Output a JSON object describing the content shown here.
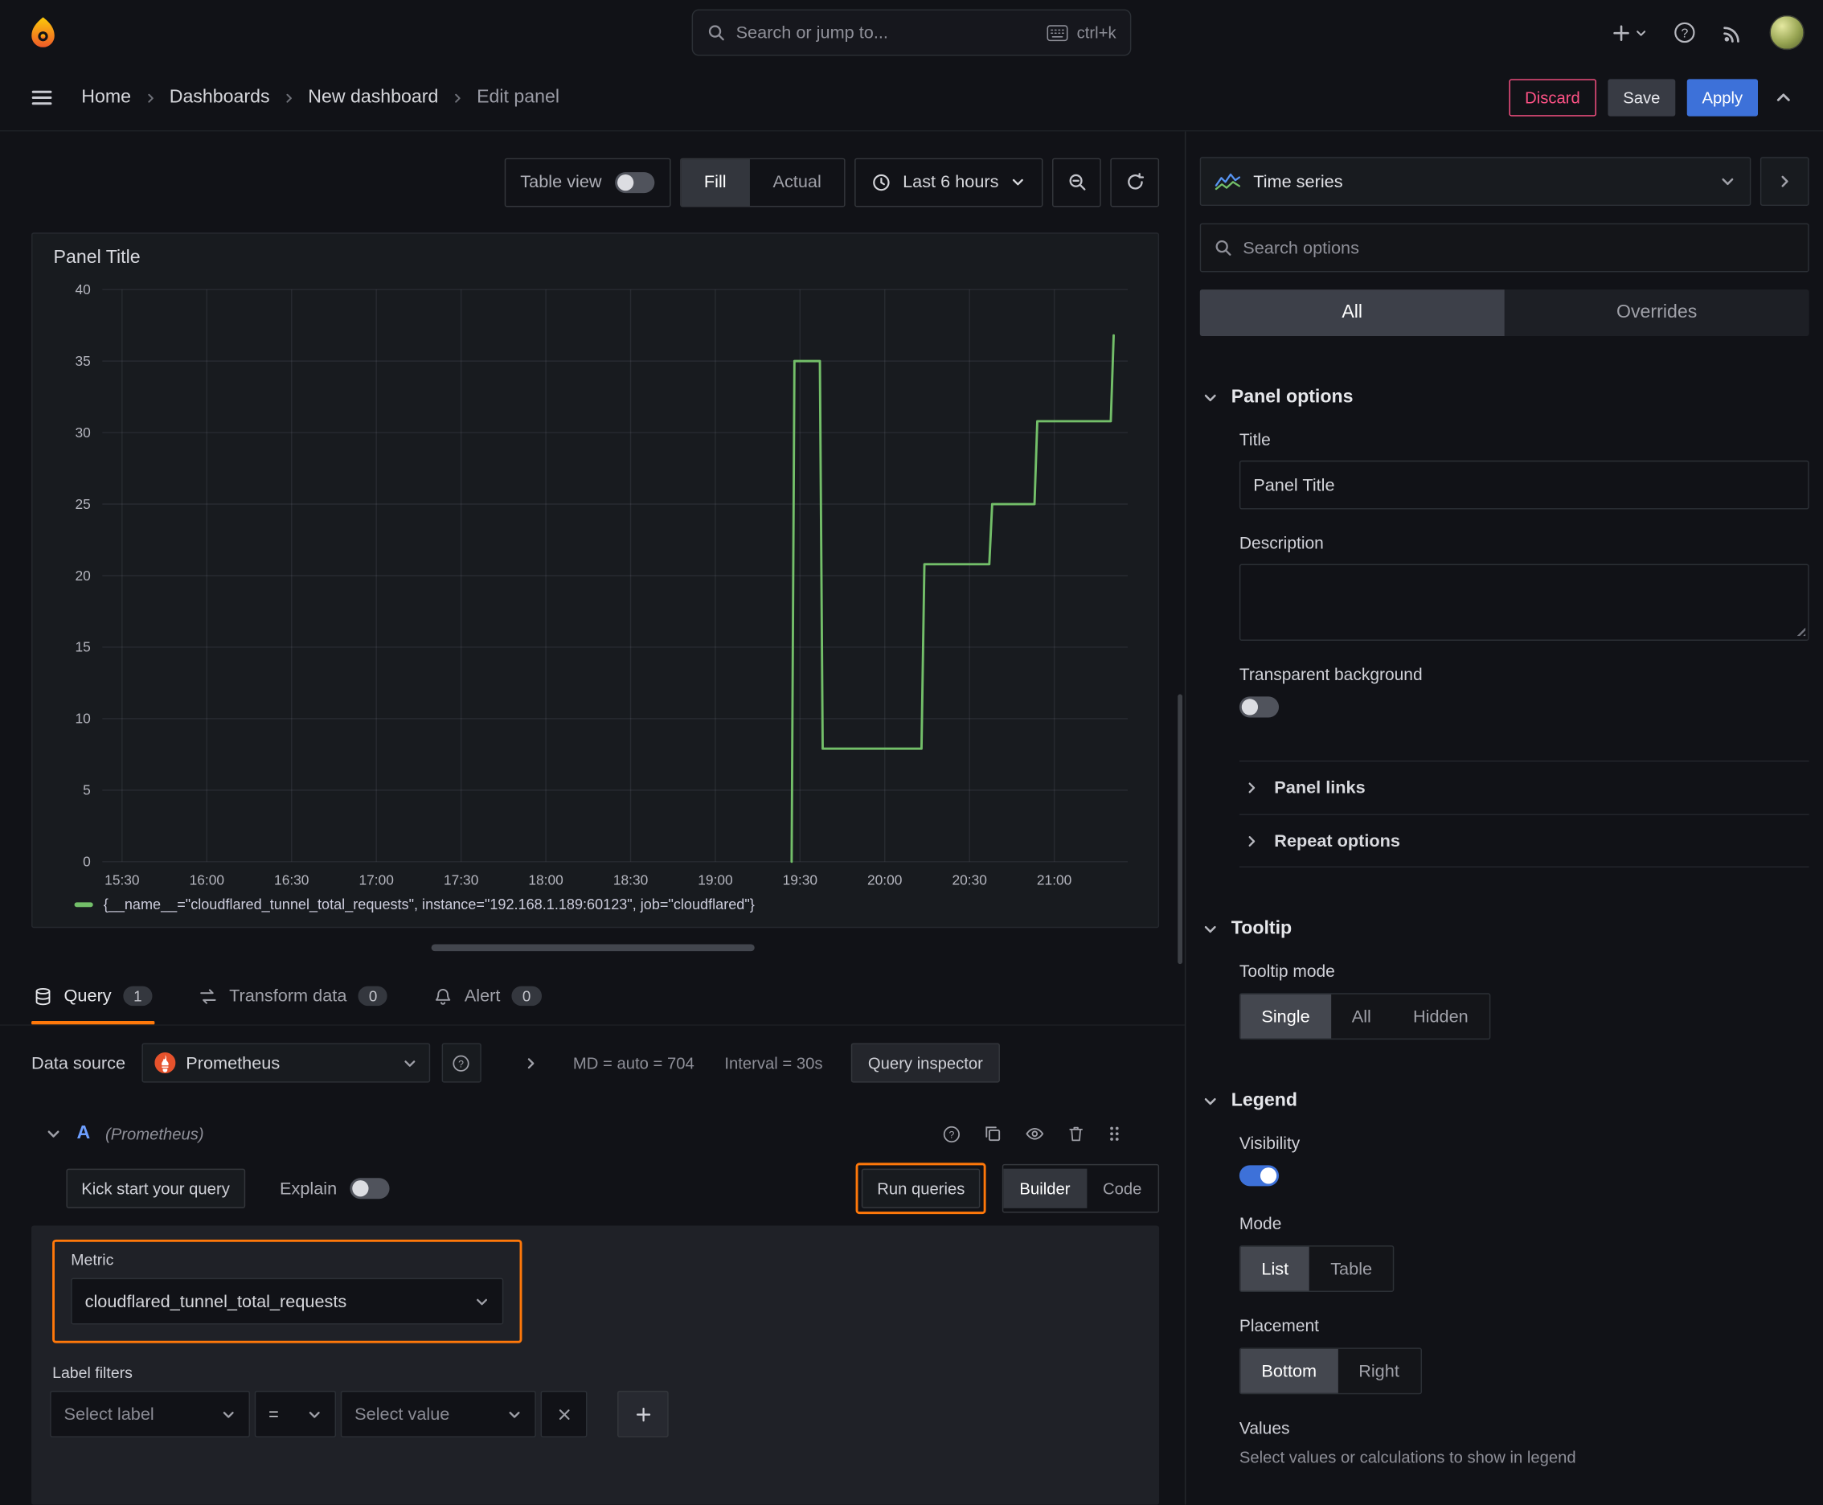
{
  "topbar": {
    "search_placeholder": "Search or jump to...",
    "shortcut": "ctrl+k"
  },
  "breadcrumb": {
    "items": [
      "Home",
      "Dashboards",
      "New dashboard",
      "Edit panel"
    ]
  },
  "actions": {
    "discard": "Discard",
    "save": "Save",
    "apply": "Apply"
  },
  "toolbar": {
    "table_view": "Table view",
    "fill": "Fill",
    "actual": "Actual",
    "time_range": "Last 6 hours"
  },
  "panel": {
    "title": "Panel Title"
  },
  "chart_data": {
    "type": "line",
    "title": "Panel Title",
    "x_domain": [
      "15:23",
      "21:26"
    ],
    "x_ticks": [
      "15:30",
      "16:00",
      "16:30",
      "17:00",
      "17:30",
      "18:00",
      "18:30",
      "19:00",
      "19:30",
      "20:00",
      "20:30",
      "21:00"
    ],
    "y_ticks": [
      0,
      5,
      10,
      15,
      20,
      25,
      30,
      35,
      40
    ],
    "ylim": [
      0,
      40
    ],
    "grid": true,
    "legend_position": "bottom",
    "series": [
      {
        "name": "{__name__=\"cloudflared_tunnel_total_requests\", instance=\"192.168.1.189:60123\", job=\"cloudflared\"}",
        "color": "#73bf69",
        "points": [
          [
            "19:27",
            0
          ],
          [
            "19:28",
            35
          ],
          [
            "19:37",
            35
          ],
          [
            "19:38",
            7.9
          ],
          [
            "20:13",
            7.9
          ],
          [
            "20:14",
            20.8
          ],
          [
            "20:37",
            20.8
          ],
          [
            "20:38",
            25
          ],
          [
            "20:53",
            25
          ],
          [
            "20:54",
            30.8
          ],
          [
            "21:20",
            30.8
          ],
          [
            "21:21",
            36.8
          ]
        ]
      }
    ]
  },
  "tabs": {
    "query": {
      "label": "Query",
      "count": "1"
    },
    "transform": {
      "label": "Transform data",
      "count": "0"
    },
    "alert": {
      "label": "Alert",
      "count": "0"
    }
  },
  "query_editor": {
    "datasource_label": "Data source",
    "datasource": "Prometheus",
    "stats": "MD = auto = 704",
    "interval": "Interval = 30s",
    "query_inspector": "Query inspector",
    "ref_id": "A",
    "ref_ds": "(Prometheus)",
    "kick_start": "Kick start your query",
    "explain": "Explain",
    "run_queries": "Run queries",
    "builder": "Builder",
    "code": "Code",
    "metric_label": "Metric",
    "metric_value": "cloudflared_tunnel_total_requests",
    "label_filters_label": "Label filters",
    "select_label": "Select label",
    "operator": "=",
    "select_value": "Select value"
  },
  "sidebar": {
    "viz_type": "Time series",
    "search_placeholder": "Search options",
    "tab_all": "All",
    "tab_overrides": "Overrides",
    "panel_options": {
      "title": "Panel options",
      "title_label": "Title",
      "title_value": "Panel Title",
      "description_label": "Description",
      "transparent_label": "Transparent background",
      "panel_links": "Panel links",
      "repeat_options": "Repeat options"
    },
    "tooltip": {
      "title": "Tooltip",
      "mode_label": "Tooltip mode",
      "options": [
        "Single",
        "All",
        "Hidden"
      ],
      "selected": "Single"
    },
    "legend": {
      "title": "Legend",
      "visibility_label": "Visibility",
      "mode_label": "Mode",
      "mode_options": [
        "List",
        "Table"
      ],
      "placement_label": "Placement",
      "placement_options": [
        "Bottom",
        "Right"
      ],
      "values_label": "Values",
      "values_desc": "Select values or calculations to show in legend"
    }
  },
  "icons": {
    "grafana_logo": "flame swirl",
    "search": "magnifier",
    "keyboard": "keyboard",
    "add": "plus",
    "help": "question circle",
    "news": "broadcast arcs",
    "menu": "hamburger",
    "chevron_down": "v",
    "chevron_right": ">",
    "chevron_up": "^",
    "clock": "clock",
    "zoom_out": "magnifier minus",
    "refresh": "circular arrow",
    "database": "cylinder",
    "transform": "swap arrows",
    "bell": "bell",
    "prometheus": "orange torch",
    "copy": "two squares",
    "eye": "eye",
    "trash": "bin",
    "drag_handle": "six dots",
    "close": "x",
    "time_series_viz": "mini line chart"
  },
  "colors": {
    "accent_orange": "#ff780a",
    "series_green": "#73bf69",
    "primary_blue": "#3d71d9",
    "danger_red": "#ff5286",
    "bg": "#111217",
    "surface": "#181b1f",
    "border": "#2c3036",
    "text": "#ccccdc",
    "dim": "#8e8f98"
  }
}
